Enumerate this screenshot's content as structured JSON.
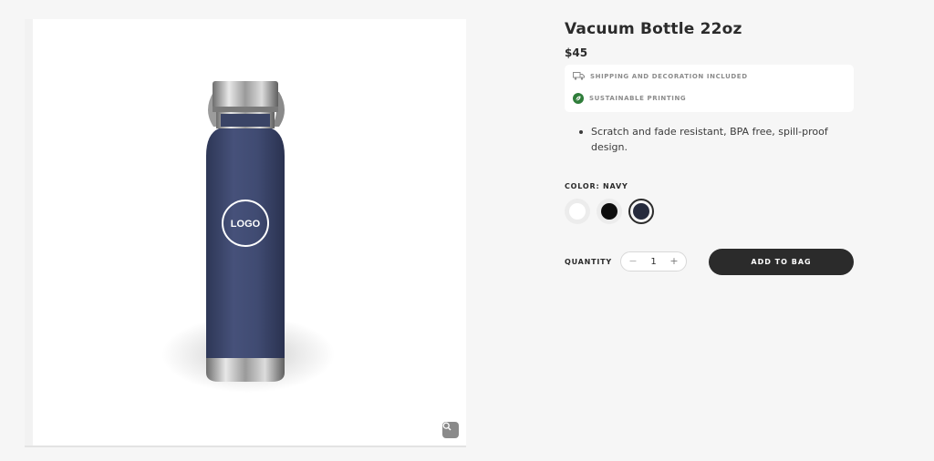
{
  "product": {
    "title": "Vacuum Bottle 22oz",
    "price": "$45",
    "image": {
      "logo_text": "LOGO",
      "bottle_color": "#3f4a70"
    }
  },
  "info_box": {
    "shipping_text": "SHIPPING AND DECORATION INCLUDED",
    "shipping_icon": "truck-icon",
    "sustainable_text": "SUSTAINABLE PRINTING",
    "sustainable_icon": "leaf-icon"
  },
  "description": {
    "bullets": [
      "Scratch and fade resistant, BPA free, spill-proof design."
    ]
  },
  "color": {
    "label": "COLOR: NAVY",
    "selected": "navy",
    "options": [
      {
        "name": "white",
        "hex": "#ffffff"
      },
      {
        "name": "black",
        "hex": "#0d0d0d"
      },
      {
        "name": "navy",
        "hex": "#262b3d"
      }
    ]
  },
  "quantity": {
    "label": "QUANTITY",
    "value": "1",
    "minus": "−",
    "plus": "+"
  },
  "actions": {
    "add_to_bag": "ADD TO BAG"
  },
  "theme": {
    "accent": "#2b2b2b",
    "background": "#f6f6f6",
    "leaf_green": "#2f7d3a"
  }
}
